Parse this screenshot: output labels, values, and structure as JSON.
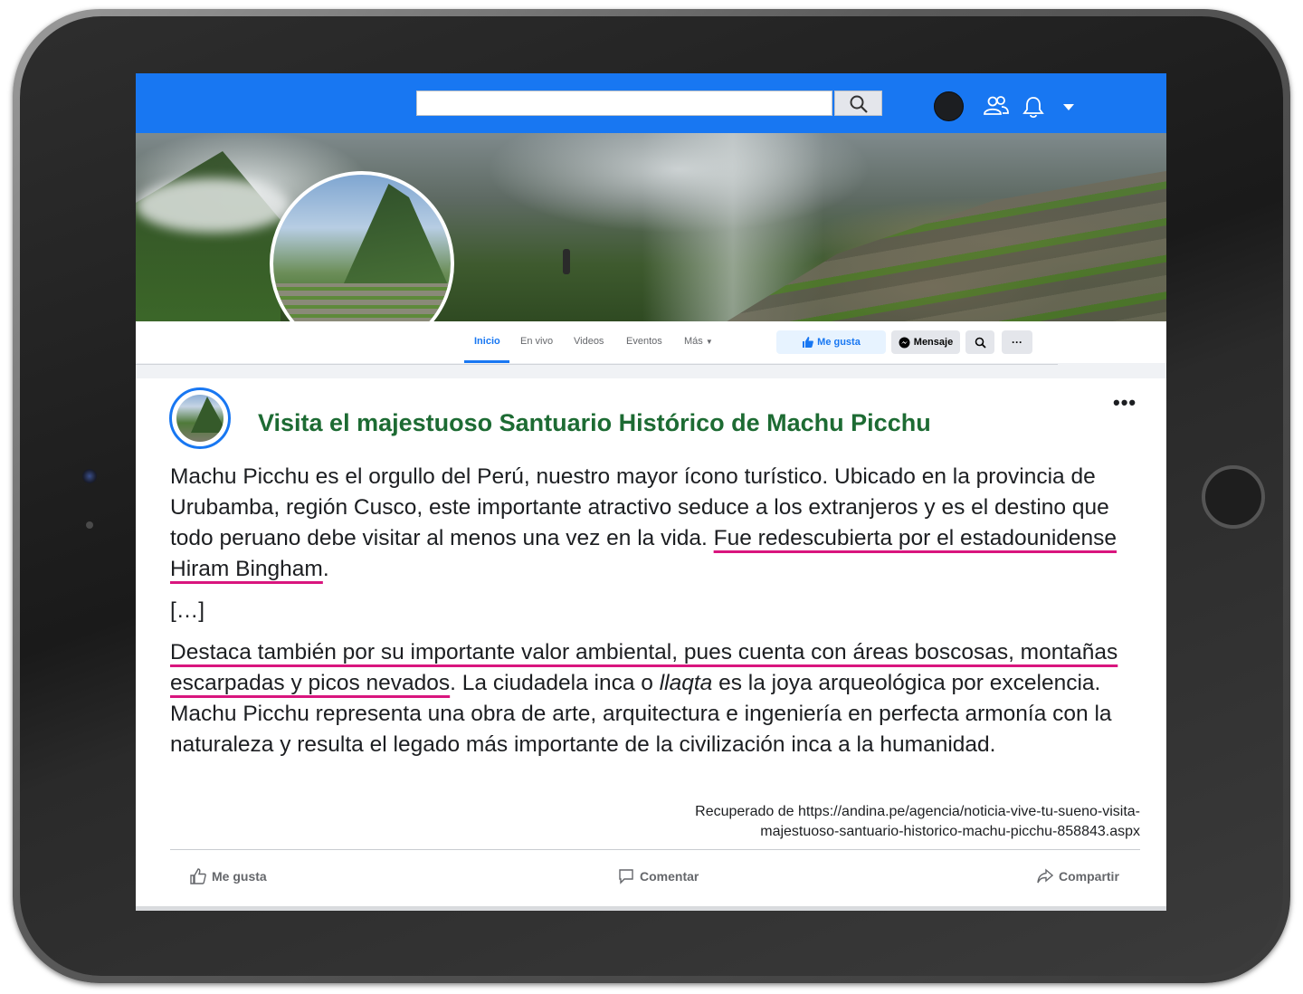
{
  "header": {
    "search": {
      "value": "",
      "placeholder": ""
    },
    "icons": [
      "search-icon",
      "avatar",
      "friends-icon",
      "bell-icon",
      "caret-down-icon"
    ]
  },
  "page_nav": {
    "tabs": [
      "Inicio",
      "En vivo",
      "Videos",
      "Eventos",
      "Más"
    ],
    "active_tab": "Inicio",
    "like_button": "Me gusta",
    "message_button": "Mensaje",
    "more_button": "···"
  },
  "post": {
    "title": "Visita el majestuoso Santuario Histórico de Machu Picchu",
    "options": "•••",
    "p1_a": "Machu Picchu es el orgullo del Perú, nuestro mayor ícono turístico. Ubicado en la provincia de Urubamba, región Cusco, este importante atractivo seduce a los extranjeros y es el destino que todo peruano debe visitar al menos una vez en la vida. ",
    "p1_underlined": "Fue redescubierta por el estadounidense Hiram Bingham",
    "p1_end": ".",
    "ellipsis": "[…]",
    "p2_underlined": "Destaca también por su importante valor ambiental, pues cuenta con áreas boscosas, montañas escarpadas y picos nevados",
    "p2_b": ". La ciudadela inca o ",
    "p2_italic": "llaqta",
    "p2_c": " es la joya arqueológica por excelencia. Machu Picchu representa una obra de arte, arquitectura e ingeniería en perfecta armonía con la naturaleza y resulta el legado más importante de la civilización inca a la humanidad.",
    "source_line1": "Recuperado de https://andina.pe/agencia/noticia-vive-tu-sueno-visita-",
    "source_line2": "majestuoso-santuario-historico-machu-picchu-858843.aspx"
  },
  "actions": {
    "like": "Me gusta",
    "comment": "Comentar",
    "share": "Compartir"
  },
  "colors": {
    "topbar": "#1877f2",
    "title_green": "#1d6b33",
    "underline_magenta": "#d9157e"
  }
}
